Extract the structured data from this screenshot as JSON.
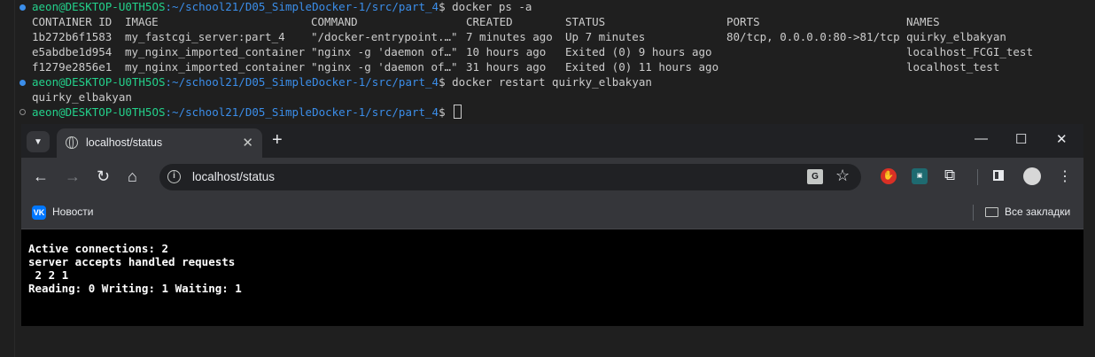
{
  "terminal": {
    "user": "aeon@DESKTOP-U0TH5OS",
    "path": ":~/school21/D05_SimpleDocker-1/src/part_4",
    "dollar": "$ ",
    "cmd1": "docker ps -a",
    "cmd2": "docker restart quirky_elbakyan",
    "cmd2_output": "quirky_elbakyan",
    "headers": [
      "CONTAINER ID",
      "IMAGE",
      "COMMAND",
      "CREATED",
      "STATUS",
      "PORTS",
      "NAMES"
    ],
    "rows": [
      [
        "1b272b6f1583",
        "my_fastcgi_server:part_4",
        "\"/docker-entrypoint.…\"",
        "7 minutes ago",
        "Up 7 minutes",
        "80/tcp, 0.0.0.0:80->81/tcp",
        "quirky_elbakyan"
      ],
      [
        "e5abdbe1d954",
        "my_nginx_imported_container",
        "\"nginx -g 'daemon of…\"",
        "10 hours ago",
        "Exited (0) 9 hours ago",
        "",
        "localhost_FCGI_test"
      ],
      [
        "f1279e2856e1",
        "my_nginx_imported_container",
        "\"nginx -g 'daemon of…\"",
        "31 hours ago",
        "Exited (0) 11 hours ago",
        "",
        "localhost_test"
      ]
    ]
  },
  "browser": {
    "tab_title": "localhost/status",
    "tab_close": "✕",
    "new_tab": "+",
    "window": {
      "minimize": "—",
      "maximize": "☐",
      "close": "✕"
    },
    "nav": {
      "back": "←",
      "forward": "→",
      "reload": "↻",
      "home": "⌂"
    },
    "url": "localhost/status",
    "bookmark_label": "Новости",
    "all_bookmarks_label": "Все закладки",
    "page_lines": [
      "Active connections: 2",
      "server accepts handled requests",
      " 2 2 1",
      "Reading: 0 Writing: 1 Waiting: 1"
    ]
  },
  "colors": {
    "prompt_user": "#23d18b",
    "prompt_path": "#3b8eea",
    "terminal_bg": "#1f1f1f",
    "browser_frame": "#35363a",
    "page_bg": "#000000"
  },
  "icons": [
    "chevron-down-icon",
    "globe-icon",
    "close-icon",
    "plus-icon",
    "minimize-icon",
    "maximize-icon",
    "back-icon",
    "forward-icon",
    "reload-icon",
    "home-icon",
    "info-icon",
    "translate-icon",
    "star-icon",
    "extension-red-icon",
    "extension-teal-icon",
    "puzzle-icon",
    "side-panel-icon",
    "avatar",
    "menu-icon",
    "vk-icon",
    "folder-icon"
  ]
}
